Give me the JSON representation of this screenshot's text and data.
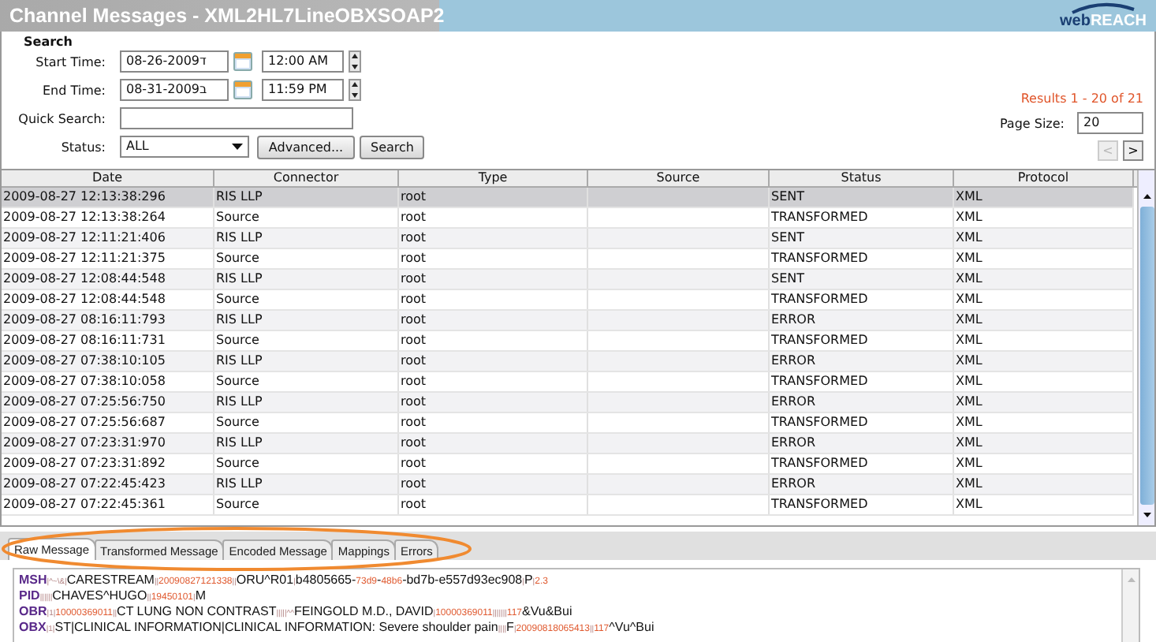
{
  "window": {
    "title": "Channel Messages - XML2HL7LineOBXSOAP2",
    "logo": [
      "web",
      "REACH"
    ]
  },
  "search": {
    "heading": "Search",
    "start_time": {
      "label": "Start Time:",
      "date": "08-26-2009ד",
      "time": "12:00 AM"
    },
    "end_time": {
      "label": "End Time:",
      "date": "08-31-2009ב",
      "time": "11:59 PM"
    },
    "quick_search": {
      "label": "Quick Search:"
    },
    "status": {
      "label": "Status:",
      "value": "ALL"
    },
    "buttons": [
      "Advanced...",
      "Search"
    ],
    "results": "Results 1 - 20 of 21",
    "page_size": {
      "label": "Page Size:",
      "value": "20"
    },
    "pager": [
      {
        "label": "<",
        "disabled": true
      },
      {
        "label": ">",
        "disabled": false
      }
    ]
  },
  "table": {
    "columns": [
      "Date",
      "Connector",
      "Type",
      "Source",
      "Status",
      "Protocol"
    ],
    "rows": [
      {
        "date": "2009-08-27 12:13:38:296",
        "connector": "RIS LLP",
        "type": "root",
        "source": "",
        "status": "SENT",
        "protocol": "XML",
        "selected": true
      },
      {
        "date": "2009-08-27 12:13:38:264",
        "connector": "Source",
        "type": "root",
        "source": "",
        "status": "TRANSFORMED",
        "protocol": "XML",
        "selected": false
      },
      {
        "date": "2009-08-27 12:11:21:406",
        "connector": "RIS LLP",
        "type": "root",
        "source": "",
        "status": "SENT",
        "protocol": "XML",
        "selected": false
      },
      {
        "date": "2009-08-27 12:11:21:375",
        "connector": "Source",
        "type": "root",
        "source": "",
        "status": "TRANSFORMED",
        "protocol": "XML",
        "selected": false
      },
      {
        "date": "2009-08-27 12:08:44:548",
        "connector": "RIS LLP",
        "type": "root",
        "source": "",
        "status": "SENT",
        "protocol": "XML",
        "selected": false
      },
      {
        "date": "2009-08-27 12:08:44:548",
        "connector": "Source",
        "type": "root",
        "source": "",
        "status": "TRANSFORMED",
        "protocol": "XML",
        "selected": false
      },
      {
        "date": "2009-08-27 08:16:11:793",
        "connector": "RIS LLP",
        "type": "root",
        "source": "",
        "status": "ERROR",
        "protocol": "XML",
        "selected": false
      },
      {
        "date": "2009-08-27 08:16:11:731",
        "connector": "Source",
        "type": "root",
        "source": "",
        "status": "TRANSFORMED",
        "protocol": "XML",
        "selected": false
      },
      {
        "date": "2009-08-27 07:38:10:105",
        "connector": "RIS LLP",
        "type": "root",
        "source": "",
        "status": "ERROR",
        "protocol": "XML",
        "selected": false
      },
      {
        "date": "2009-08-27 07:38:10:058",
        "connector": "Source",
        "type": "root",
        "source": "",
        "status": "TRANSFORMED",
        "protocol": "XML",
        "selected": false
      },
      {
        "date": "2009-08-27 07:25:56:750",
        "connector": "RIS LLP",
        "type": "root",
        "source": "",
        "status": "ERROR",
        "protocol": "XML",
        "selected": false
      },
      {
        "date": "2009-08-27 07:25:56:687",
        "connector": "Source",
        "type": "root",
        "source": "",
        "status": "TRANSFORMED",
        "protocol": "XML",
        "selected": false
      },
      {
        "date": "2009-08-27 07:23:31:970",
        "connector": "RIS LLP",
        "type": "root",
        "source": "",
        "status": "ERROR",
        "protocol": "XML",
        "selected": false
      },
      {
        "date": "2009-08-27 07:23:31:892",
        "connector": "Source",
        "type": "root",
        "source": "",
        "status": "TRANSFORMED",
        "protocol": "XML",
        "selected": false
      },
      {
        "date": "2009-08-27 07:22:45:423",
        "connector": "RIS LLP",
        "type": "root",
        "source": "",
        "status": "ERROR",
        "protocol": "XML",
        "selected": false
      },
      {
        "date": "2009-08-27 07:22:45:361",
        "connector": "Source",
        "type": "root",
        "source": "",
        "status": "TRANSFORMED",
        "protocol": "XML",
        "selected": false
      }
    ]
  },
  "tabs": [
    {
      "label": "Raw Message",
      "selected": true
    },
    {
      "label": "Transformed Message",
      "selected": false
    },
    {
      "label": "Encoded Message",
      "selected": false
    },
    {
      "label": "Mappings",
      "selected": false
    },
    {
      "label": "Errors",
      "selected": false
    }
  ],
  "message_lines": [
    [
      {
        "kind": "segment",
        "text": "MSH"
      },
      {
        "kind": "sep",
        "text": "|^~\\&|"
      },
      {
        "kind": "text",
        "text": "CARESTREAM"
      },
      {
        "kind": "sep",
        "text": "||"
      },
      {
        "kind": "number",
        "text": "20090827121338"
      },
      {
        "kind": "sep",
        "text": "||"
      },
      {
        "kind": "text",
        "text": "ORU^R01"
      },
      {
        "kind": "sep",
        "text": "|"
      },
      {
        "kind": "text",
        "text": "b4805665-"
      },
      {
        "kind": "number",
        "text": "73d9"
      },
      {
        "kind": "text",
        "text": "-"
      },
      {
        "kind": "number",
        "text": "48b6"
      },
      {
        "kind": "text",
        "text": "-bd7b-e557d93ec908"
      },
      {
        "kind": "sep",
        "text": "|"
      },
      {
        "kind": "text",
        "text": "P"
      },
      {
        "kind": "sep",
        "text": "|"
      },
      {
        "kind": "number",
        "text": "2.3"
      }
    ],
    [
      {
        "kind": "segment",
        "text": "PID"
      },
      {
        "kind": "sep",
        "text": "||||||"
      },
      {
        "kind": "text",
        "text": "CHAVES^HUGO"
      },
      {
        "kind": "sep",
        "text": "||"
      },
      {
        "kind": "number",
        "text": "19450101"
      },
      {
        "kind": "sep",
        "text": "|"
      },
      {
        "kind": "text",
        "text": "M"
      }
    ],
    [
      {
        "kind": "segment",
        "text": "OBR"
      },
      {
        "kind": "sep",
        "text": "|1|"
      },
      {
        "kind": "number",
        "text": "10000369011"
      },
      {
        "kind": "sep",
        "text": "||"
      },
      {
        "kind": "text",
        "text": "CT LUNG NON CONTRAST"
      },
      {
        "kind": "sep",
        "text": "|||||^^"
      },
      {
        "kind": "text",
        "text": "FEINGOLD M.D., DAVID"
      },
      {
        "kind": "sep",
        "text": "|"
      },
      {
        "kind": "number",
        "text": "10000369011"
      },
      {
        "kind": "sep",
        "text": "|||||||"
      },
      {
        "kind": "number",
        "text": "117"
      },
      {
        "kind": "text",
        "text": "&Vu&Bui"
      }
    ],
    [
      {
        "kind": "segment",
        "text": "OBX"
      },
      {
        "kind": "sep",
        "text": "|1|"
      },
      {
        "kind": "text",
        "text": "ST|CLINICAL INFORMATION|CLINICAL INFORMATION:    Severe shoulder pain"
      },
      {
        "kind": "sep",
        "text": "||||"
      },
      {
        "kind": "text",
        "text": "F"
      },
      {
        "kind": "sep",
        "text": "|"
      },
      {
        "kind": "number",
        "text": "20090818065413"
      },
      {
        "kind": "sep",
        "text": "||"
      },
      {
        "kind": "number",
        "text": "117"
      },
      {
        "kind": "text",
        "text": "^Vu^Bui"
      }
    ]
  ]
}
